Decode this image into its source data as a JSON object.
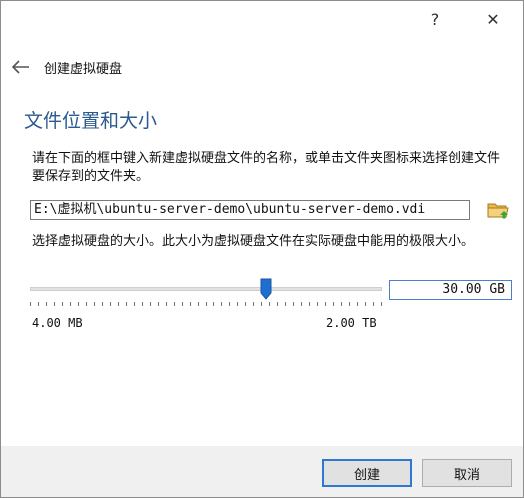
{
  "window": {
    "help_label": "?",
    "close_label": "✕"
  },
  "header": {
    "back_icon": "back-arrow-icon",
    "title": "创建虚拟硬盘"
  },
  "section": {
    "title": "文件位置和大小",
    "location_description": "请在下面的框中键入新建虚拟硬盘文件的名称，或单击文件夹图标来选择创建文件要保存到的文件夹。",
    "size_description": "选择虚拟硬盘的大小。此大小为虚拟硬盘文件在实际硬盘中能用的极限大小。"
  },
  "location": {
    "value": "E:\\虚拟机\\ubuntu-server-demo\\ubuntu-server-demo.vdi",
    "folder_icon": "folder-icon"
  },
  "size": {
    "value": "30.00 GB",
    "min_label": "4.00 MB",
    "max_label": "2.00 TB",
    "slider_fraction": 0.67
  },
  "buttons": {
    "create": "创建",
    "cancel": "取消"
  },
  "colors": {
    "accent": "#2f78d0",
    "section_title": "#2a5a8f",
    "footer_bg": "#f0f0f0"
  }
}
